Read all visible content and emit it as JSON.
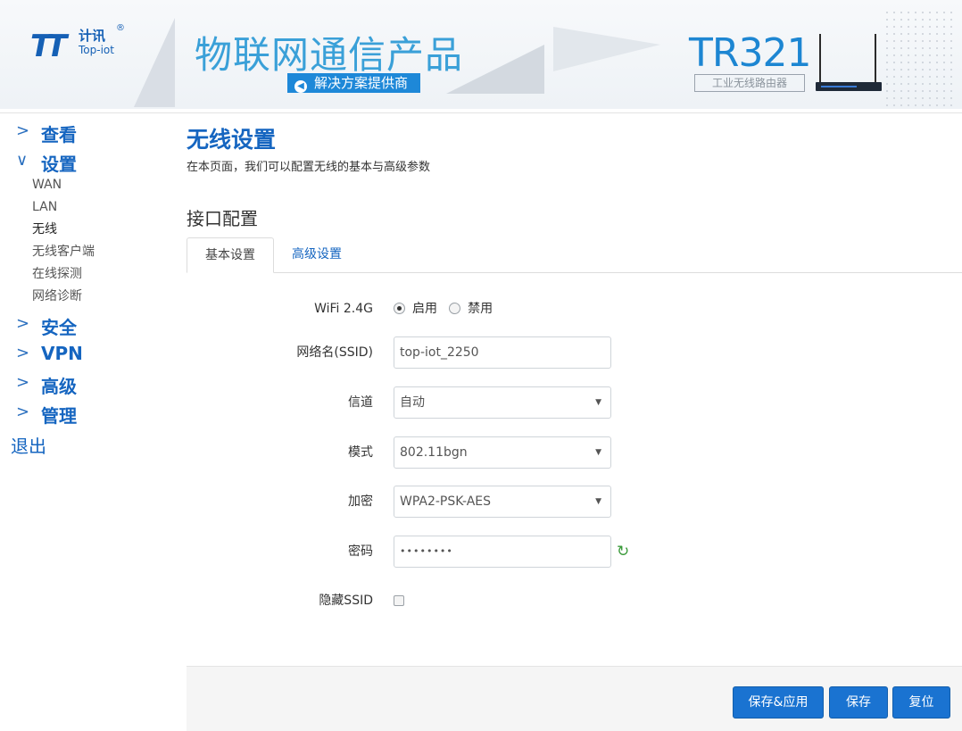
{
  "banner": {
    "logo_cn": "计讯",
    "logo_en": "Top-iot",
    "logo_reg": "®",
    "headline": "物联网通信产品",
    "tagline": "解决方案提供商",
    "model": "TR321",
    "model_sub": "工业无线路由器"
  },
  "sidebar": {
    "groups": [
      {
        "label": "查看",
        "chevron": ">"
      },
      {
        "label": "设置",
        "chevron": "∨"
      },
      {
        "label": "安全",
        "chevron": ">"
      },
      {
        "label": "VPN",
        "chevron": ">"
      },
      {
        "label": "高级",
        "chevron": ">"
      },
      {
        "label": "管理",
        "chevron": ">"
      }
    ],
    "settings_items": [
      {
        "label": "WAN"
      },
      {
        "label": "LAN"
      },
      {
        "label": "无线"
      },
      {
        "label": "无线客户端"
      },
      {
        "label": "在线探测"
      },
      {
        "label": "网络诊断"
      }
    ],
    "logout": "退出"
  },
  "page": {
    "title": "无线设置",
    "description": "在本页面，我们可以配置无线的基本与高级参数",
    "section_title": "接口配置",
    "tabs": [
      {
        "label": "基本设置",
        "active": true
      },
      {
        "label": "高级设置",
        "active": false
      }
    ]
  },
  "form": {
    "wifi": {
      "label": "WiFi 2.4G",
      "enable": "启用",
      "disable": "禁用",
      "selected": "启用"
    },
    "ssid": {
      "label": "网络名(SSID)",
      "value": "top-iot_2250"
    },
    "channel": {
      "label": "信道",
      "value": "自动"
    },
    "mode": {
      "label": "模式",
      "value": "802.11bgn"
    },
    "encryption": {
      "label": "加密",
      "value": "WPA2-PSK-AES"
    },
    "password": {
      "label": "密码",
      "value": "••••••••"
    },
    "hide_ssid": {
      "label": "隐藏SSID",
      "checked": false
    }
  },
  "actions": {
    "save_apply": "保存&应用",
    "save": "保存",
    "reset": "复位"
  },
  "colors": {
    "accent": "#1565c0",
    "button": "#1a73d1",
    "headline": "#3aa0d8"
  }
}
